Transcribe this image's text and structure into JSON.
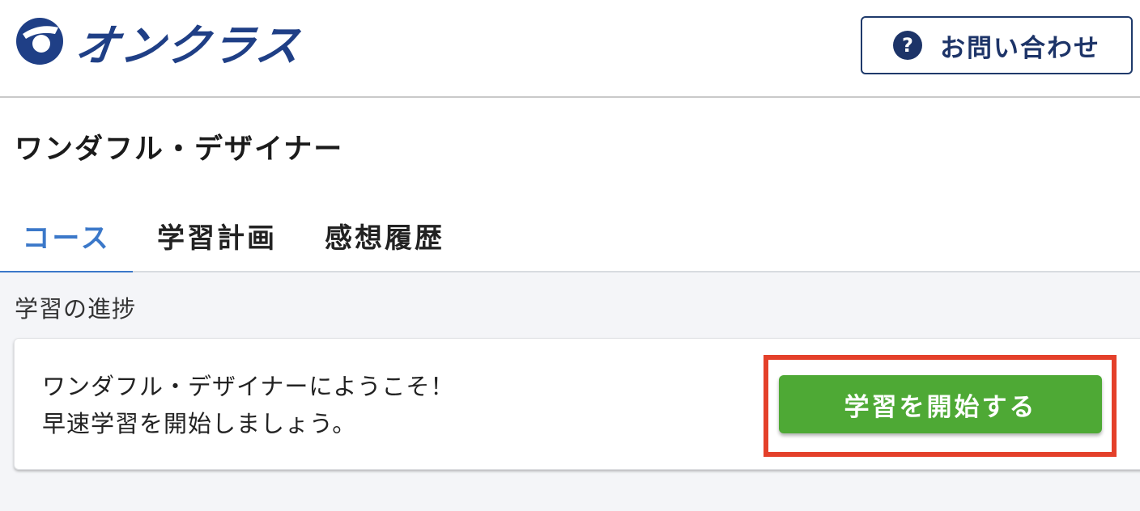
{
  "header": {
    "logo_text": "オンクラス",
    "logo_icon": "onclass-logo-icon",
    "contact_label": "お問い合わせ",
    "contact_icon": "question-circle-icon"
  },
  "course": {
    "title": "ワンダフル・デザイナー"
  },
  "tabs": [
    {
      "label": "コース",
      "active": true
    },
    {
      "label": "学習計画",
      "active": false
    },
    {
      "label": "感想履歴",
      "active": false
    }
  ],
  "progress": {
    "section_label": "学習の進捗",
    "message_line1": "ワンダフル・デザイナーにようこそ！",
    "message_line2": "早速学習を開始しましょう。",
    "start_button_label": "学習を開始する"
  },
  "colors": {
    "brand": "#1f3f86",
    "tab_active": "#3b78c9",
    "start_button": "#4ea935",
    "highlight": "#e4402a"
  }
}
